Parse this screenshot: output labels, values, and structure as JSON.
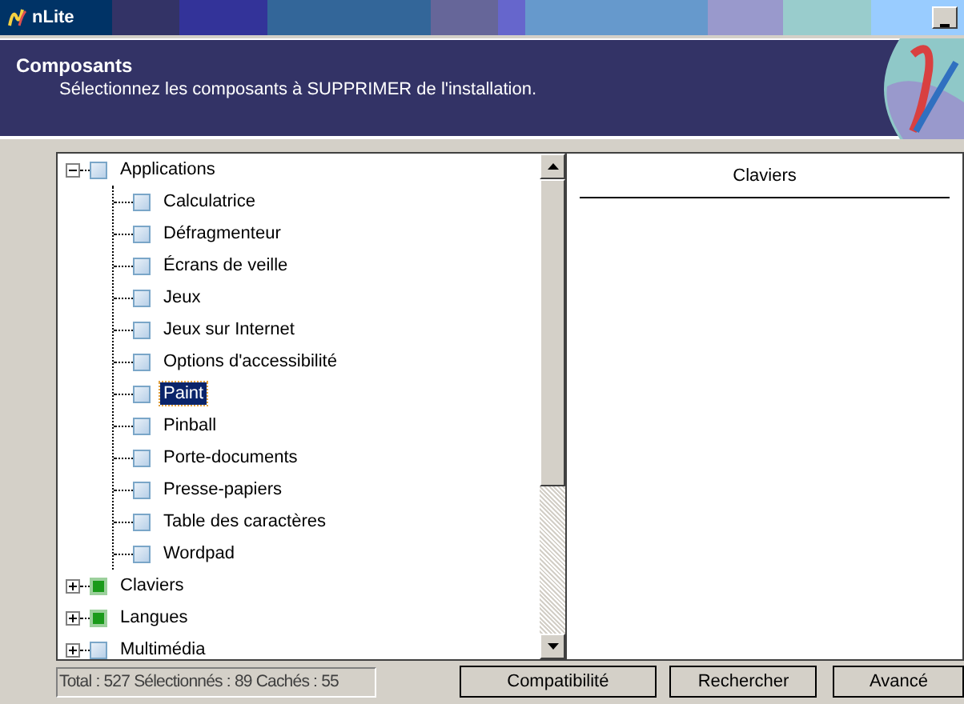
{
  "window": {
    "title": "nLite"
  },
  "header": {
    "title": "Composants",
    "subtitle": "Sélectionnez les composants à SUPPRIMER de l'installation."
  },
  "tree": [
    {
      "label": "Applications",
      "checked": false,
      "expanded": true,
      "selected": false,
      "children": [
        {
          "label": "Calculatrice",
          "checked": false,
          "selected": false
        },
        {
          "label": "Défragmenteur",
          "checked": false,
          "selected": false
        },
        {
          "label": "Écrans de veille",
          "checked": false,
          "selected": false
        },
        {
          "label": "Jeux",
          "checked": false,
          "selected": false
        },
        {
          "label": "Jeux sur Internet",
          "checked": false,
          "selected": false
        },
        {
          "label": "Options d'accessibilité",
          "checked": false,
          "selected": false
        },
        {
          "label": "Paint",
          "checked": false,
          "selected": true
        },
        {
          "label": "Pinball",
          "checked": false,
          "selected": false
        },
        {
          "label": "Porte-documents",
          "checked": false,
          "selected": false
        },
        {
          "label": "Presse-papiers",
          "checked": false,
          "selected": false
        },
        {
          "label": "Table des caractères",
          "checked": false,
          "selected": false
        },
        {
          "label": "Wordpad",
          "checked": false,
          "selected": false
        }
      ]
    },
    {
      "label": "Claviers",
      "checked": true,
      "expanded": false,
      "selected": false
    },
    {
      "label": "Langues",
      "checked": true,
      "expanded": false,
      "selected": false
    },
    {
      "label": "Multimédia",
      "checked": false,
      "expanded": false,
      "selected": false
    }
  ],
  "details": {
    "title": "Claviers"
  },
  "status_bar": "Total : 527 Sélectionnés : 89 Cachés : 55",
  "buttons": [
    "Compatibilité",
    "Rechercher",
    "Avancé"
  ]
}
